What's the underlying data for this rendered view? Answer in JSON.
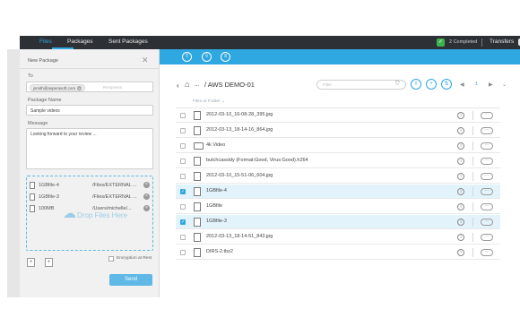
{
  "nav": {
    "files": "Files",
    "packages": "Packages",
    "sent_packages": "Sent Packages",
    "status": "2 Completed",
    "transfers": "Transfers"
  },
  "package": {
    "title": "New Package",
    "to_label": "To",
    "recipient_chip": "jsmith@asperasoft.com",
    "recipient_placeholder": "Recipients",
    "name_label": "Package Name",
    "name_value": "Sample videos",
    "message_label": "Message",
    "message_value": "Looking forward to your review ...",
    "files": [
      {
        "name": "1GBfile-4",
        "path": "/Files/EXTERNAL ..."
      },
      {
        "name": "1GBfile-3",
        "path": "/Files/EXTERNAL ..."
      },
      {
        "name": "100MB",
        "path": "/Users/michelle/..."
      }
    ],
    "drop_text": "Drop Files Here",
    "encryption_label": "Encryption at Rest",
    "send_label": "Send"
  },
  "browser": {
    "breadcrumb_dots": "...",
    "breadcrumb_path": "/ AWS DEMO-01",
    "filter_placeholder": "Filter",
    "page": "1",
    "column_header": "Files or Folder ⌄",
    "rows": [
      {
        "name": "2012-03-10_16-08-28_395.jpg",
        "type": "file",
        "checked": false
      },
      {
        "name": "2012-03-13_18-14-16_864.jpg",
        "type": "file",
        "checked": false
      },
      {
        "name": "4k Video",
        "type": "folder",
        "checked": false
      },
      {
        "name": "butchcassidy (Format:Good, Virus:Good).h264",
        "type": "file",
        "checked": false
      },
      {
        "name": "2012-03-10_15-51-06_604.jpg",
        "type": "file",
        "checked": false
      },
      {
        "name": "1GBfile-4",
        "type": "file",
        "checked": true
      },
      {
        "name": "1GBfile",
        "type": "file",
        "checked": false
      },
      {
        "name": "1GBfile-3",
        "type": "file",
        "checked": true
      },
      {
        "name": "2012-03-13_18-14-51_843.jpg",
        "type": "file",
        "checked": false
      },
      {
        "name": "DIRS-2.tbz2",
        "type": "file",
        "checked": false
      }
    ]
  },
  "colors": {
    "accent": "#2fa7e0",
    "topbar": "#2d3136",
    "success": "#3fb34f",
    "selected_row": "#e3f3fb"
  }
}
